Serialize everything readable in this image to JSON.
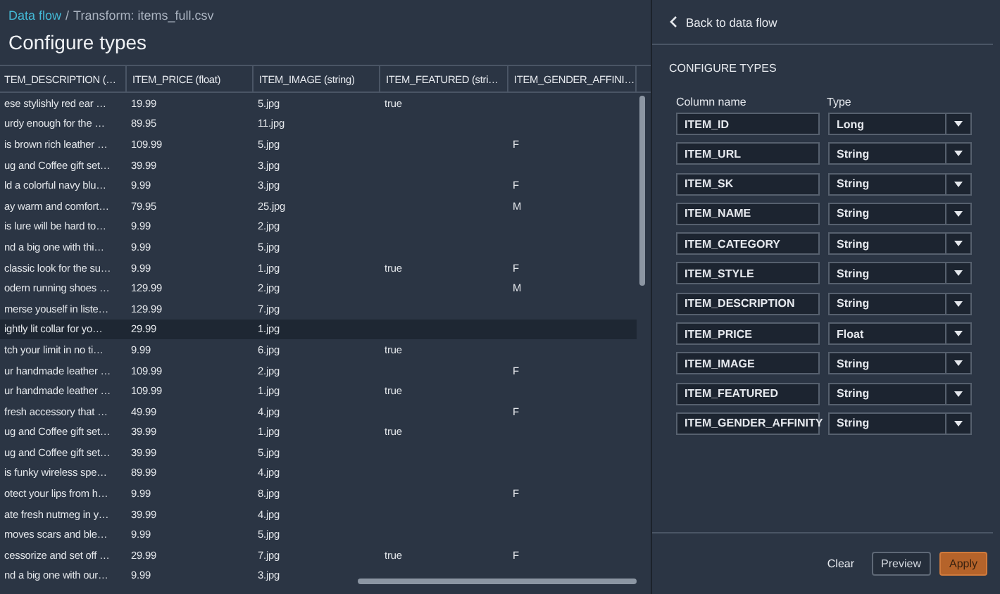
{
  "breadcrumb": {
    "link": "Data flow",
    "separator": "/",
    "current": "Transform: items_full.csv"
  },
  "title": "Configure types",
  "table": {
    "columns": [
      "TEM_DESCRIPTION (…",
      "ITEM_PRICE (float)",
      "ITEM_IMAGE (string)",
      "ITEM_FEATURED (stri…",
      "ITEM_GENDER_AFFINI…"
    ],
    "rows": [
      {
        "cells": [
          "ese stylishly red ear …",
          "19.99",
          "5.jpg",
          "true",
          null
        ],
        "selected": false
      },
      {
        "cells": [
          "urdy enough for the …",
          "89.95",
          "11.jpg",
          null,
          null
        ],
        "selected": false
      },
      {
        "cells": [
          "is brown rich leather …",
          "109.99",
          "5.jpg",
          null,
          "F"
        ],
        "selected": false
      },
      {
        "cells": [
          "ug and Coffee gift set…",
          "39.99",
          "3.jpg",
          null,
          null
        ],
        "selected": false
      },
      {
        "cells": [
          "ld a colorful navy blu…",
          "9.99",
          "3.jpg",
          null,
          "F"
        ],
        "selected": false
      },
      {
        "cells": [
          "ay warm and comfort…",
          "79.95",
          "25.jpg",
          null,
          "M"
        ],
        "selected": false
      },
      {
        "cells": [
          "is lure will be hard to…",
          "9.99",
          "2.jpg",
          null,
          null
        ],
        "selected": false
      },
      {
        "cells": [
          "nd a big one with thi…",
          "9.99",
          "5.jpg",
          null,
          null
        ],
        "selected": false
      },
      {
        "cells": [
          "classic look for the su…",
          "9.99",
          "1.jpg",
          "true",
          "F"
        ],
        "selected": false
      },
      {
        "cells": [
          "odern running shoes …",
          "129.99",
          "2.jpg",
          null,
          "M"
        ],
        "selected": false
      },
      {
        "cells": [
          "merse youself in liste…",
          "129.99",
          "7.jpg",
          null,
          null
        ],
        "selected": false
      },
      {
        "cells": [
          "ightly lit collar for yo…",
          "29.99",
          "1.jpg",
          null,
          null
        ],
        "selected": true
      },
      {
        "cells": [
          "tch your limit in no ti…",
          "9.99",
          "6.jpg",
          "true",
          null
        ],
        "selected": false
      },
      {
        "cells": [
          "ur handmade leather …",
          "109.99",
          "2.jpg",
          null,
          "F"
        ],
        "selected": false
      },
      {
        "cells": [
          "ur handmade leather …",
          "109.99",
          "1.jpg",
          "true",
          null
        ],
        "selected": false
      },
      {
        "cells": [
          "fresh accessory that …",
          "49.99",
          "4.jpg",
          null,
          "F"
        ],
        "selected": false
      },
      {
        "cells": [
          "ug and Coffee gift set…",
          "39.99",
          "1.jpg",
          "true",
          null
        ],
        "selected": false
      },
      {
        "cells": [
          "ug and Coffee gift set…",
          "39.99",
          "5.jpg",
          null,
          null
        ],
        "selected": false
      },
      {
        "cells": [
          "is funky wireless spe…",
          "89.99",
          "4.jpg",
          null,
          null
        ],
        "selected": false
      },
      {
        "cells": [
          "otect your lips from h…",
          "9.99",
          "8.jpg",
          null,
          "F"
        ],
        "selected": false
      },
      {
        "cells": [
          "ate fresh nutmeg in y…",
          "39.99",
          "4.jpg",
          null,
          null
        ],
        "selected": false
      },
      {
        "cells": [
          "moves scars and ble…",
          "9.99",
          "5.jpg",
          null,
          null
        ],
        "selected": false
      },
      {
        "cells": [
          "cessorize and set off …",
          "29.99",
          "7.jpg",
          "true",
          "F"
        ],
        "selected": false
      },
      {
        "cells": [
          "nd a big one with our…",
          "9.99",
          "3.jpg",
          null,
          null
        ],
        "selected": false
      }
    ]
  },
  "panel": {
    "back_link": "Back to data flow",
    "heading": "CONFIGURE TYPES",
    "name_header": "Column name",
    "type_header": "Type",
    "fields": [
      {
        "name": "ITEM_ID",
        "type": "Long"
      },
      {
        "name": "ITEM_URL",
        "type": "String"
      },
      {
        "name": "ITEM_SK",
        "type": "String"
      },
      {
        "name": "ITEM_NAME",
        "type": "String"
      },
      {
        "name": "ITEM_CATEGORY",
        "type": "String"
      },
      {
        "name": "ITEM_STYLE",
        "type": "String"
      },
      {
        "name": "ITEM_DESCRIPTION",
        "type": "String"
      },
      {
        "name": "ITEM_PRICE",
        "type": "Float"
      },
      {
        "name": "ITEM_IMAGE",
        "type": "String"
      },
      {
        "name": "ITEM_FEATURED",
        "type": "String"
      },
      {
        "name": "ITEM_GENDER_AFFINITY",
        "type": "String"
      }
    ],
    "buttons": [
      {
        "label": "Clear",
        "kind": "link"
      },
      {
        "label": "Preview",
        "kind": "secondary"
      },
      {
        "label": "Apply",
        "kind": "primary"
      }
    ]
  }
}
